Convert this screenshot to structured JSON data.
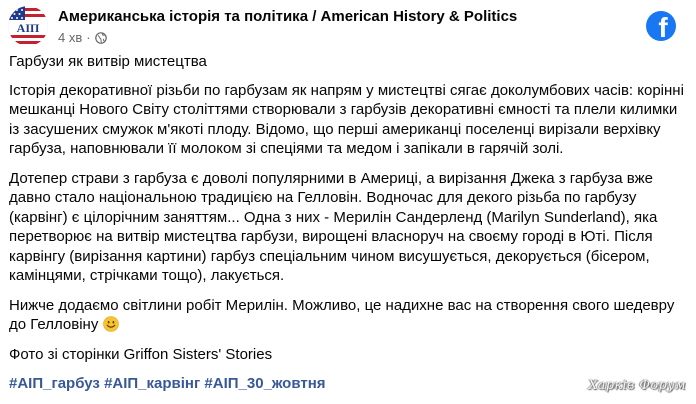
{
  "post": {
    "page_name": "Американська історія та політика / American History & Politics",
    "time": "4 хв",
    "separator": "·",
    "avatar_text": "АІП",
    "brand_icon": "facebook-icon",
    "brand_color": "#1877f2",
    "title": "Гарбузи як витвір мистецтва",
    "paragraphs": [
      "Історія декоративної різьби по гарбузам як напрям у мистецтві сягає доколумбових часів: корінні мешканці Нового Світу століттями створювали з гарбузів декоративні ємності та плели килимки із засушених смужок м'якоті плоду. Відомо, що перші американці поселенці вирізали верхівку гарбуза, наповнювали її молоком зі спеціями та медом і запікали в гарячій золі.",
      "Дотепер страви з гарбуза є доволі популярними в Америці, а вирізання Джека з гарбуза вже давно  стало національною традицією на Гелловін. Водночас для декого різьба по гарбузу (карвінг) є цілорічним заняттям... Одна з них - Мерилін Сандерленд (Marilyn Sunderland), яка перетворює на витвір мистецтва гарбузи, вирощені власноруч на своєму городі в Юті. Після карвінгу (вирізання картини) гарбуз спеціальним чином висушується, декорується (бісером, камінцями, стрічками тощо), лакується.",
      "Нижче додаємо світлини робіт Мерилін. Можливо, це надихне вас на створення свого шедевру до Гелловіну"
    ],
    "photo_credit": "Фото зі сторінки Griffon Sisters' Stories",
    "hashtags": [
      "#АІП_гарбуз",
      "#АІП_карвінг",
      "#АІП_30_жовтня"
    ],
    "watermark": "Харків Форум"
  }
}
